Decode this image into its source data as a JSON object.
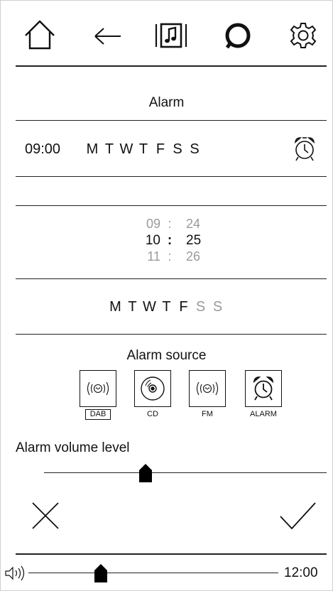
{
  "alarm_screen": {
    "title": "Alarm",
    "summary": {
      "time": "09:00",
      "days": [
        {
          "label": "M",
          "active": true
        },
        {
          "label": "T",
          "active": true
        },
        {
          "label": "W",
          "active": true
        },
        {
          "label": "T",
          "active": true
        },
        {
          "label": "F",
          "active": true
        },
        {
          "label": "S",
          "active": true
        },
        {
          "label": "S",
          "active": true
        }
      ]
    },
    "time_picker": {
      "hour_above": "09",
      "hour": "10",
      "hour_below": "11",
      "minute_above": "24",
      "minute": "25",
      "minute_below": "26",
      "separator": ":"
    },
    "day_selector": [
      {
        "label": "M",
        "active": true
      },
      {
        "label": "T",
        "active": true
      },
      {
        "label": "W",
        "active": true
      },
      {
        "label": "T",
        "active": true
      },
      {
        "label": "F",
        "active": true
      },
      {
        "label": "S",
        "active": false
      },
      {
        "label": "S",
        "active": false
      }
    ],
    "source": {
      "title": "Alarm source",
      "options": [
        {
          "label": "DAB",
          "icon": "radio-wave-icon",
          "selected": true
        },
        {
          "label": "CD",
          "icon": "cd-icon",
          "selected": false
        },
        {
          "label": "FM",
          "icon": "radio-wave-icon",
          "selected": false
        },
        {
          "label": "ALARM",
          "icon": "alarm-clock-icon",
          "selected": false
        }
      ]
    },
    "volume": {
      "label": "Alarm volume level",
      "level": 0.36
    }
  },
  "status_bar": {
    "volume_level": 0.29,
    "clock": "12:00"
  },
  "colors": {
    "text": "#111111",
    "inactive": "#9a9a9a"
  }
}
